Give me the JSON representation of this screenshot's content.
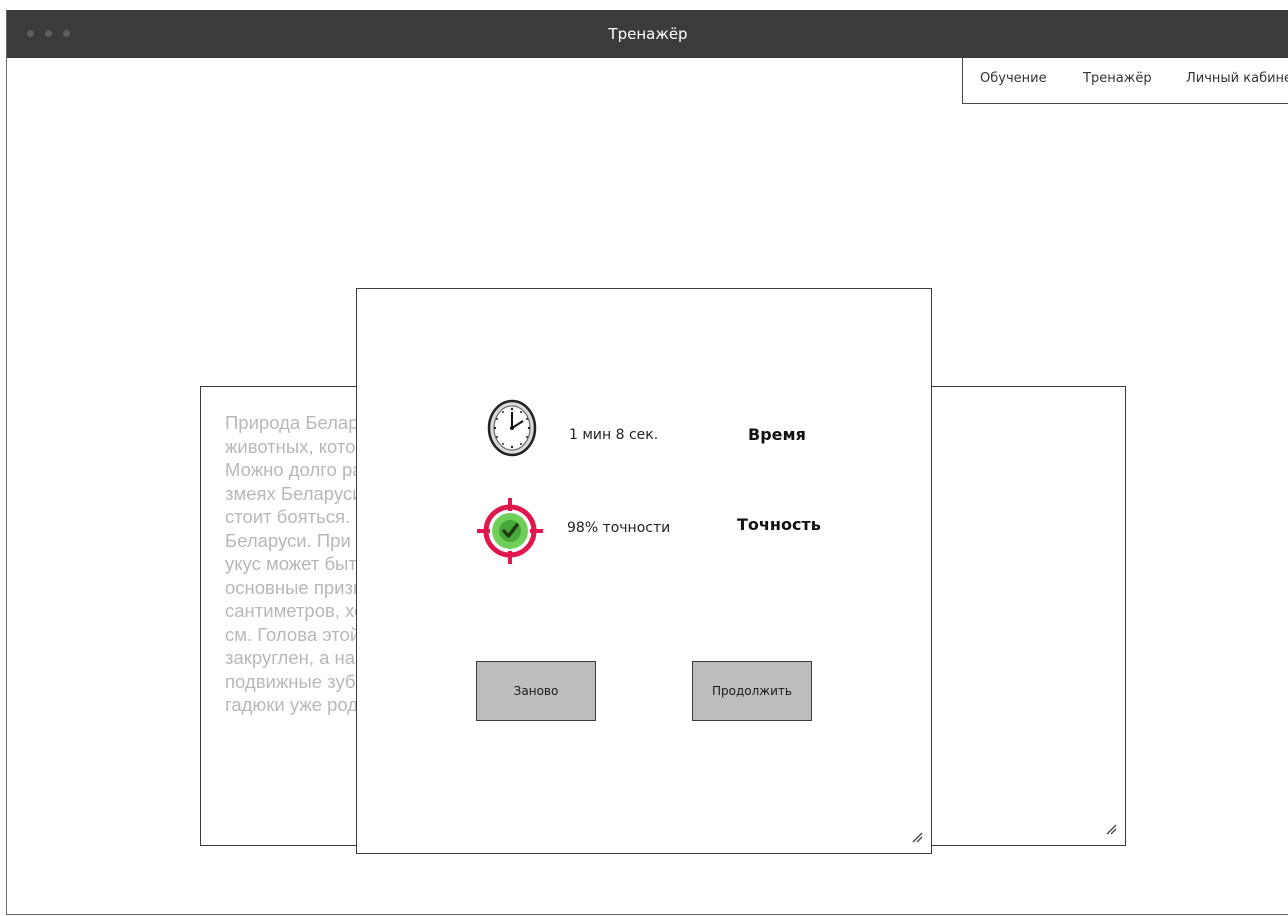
{
  "window": {
    "title": "Тренажёр"
  },
  "nav": {
    "items": [
      {
        "label": "Обучение"
      },
      {
        "label": "Тренажёр"
      },
      {
        "label": "Личный кабинет"
      }
    ]
  },
  "text_card": {
    "lines": [
      "Природа Беларуси богата: здесь обитает множество редких",
      "животных, которые занесены в Красную книгу нашей страны.",
      "Можно долго рассказывать о них, но сегодня остановиться на",
      "змеях Беларуси. Их всего несколько видов, и лишь один из них",
      "стоит бояться. Гадюка обыкновенная — единственная ядовитая змея",
      "Беларуси. При встрече с ней не стоит сильно волноваться, ведь ее",
      "укус может быть опасен лишь в редких случаях. Обратим внимание на",
      "основные признаки гадюки: длина ее тела не превышает 65",
      "сантиметров, хотя в отдельных случаях самки могут достигать 95",
      "см. Голова этой змеи треугольной формы и плоская. Кончик головы",
      "закруглен, а на верхней челюсти у нее располагаются крупные",
      "подвижные зубы. Уже при рождении, к слову, молодые",
      "гадюки уже родятся ядовитыми, как у взрослых змей."
    ]
  },
  "results": {
    "time_value": "1 мин 8 сек.",
    "time_label": "Время",
    "accuracy_value": "98% точности",
    "accuracy_label": "Точность",
    "accuracy_percent": 98,
    "icons": {
      "time": "clock-icon",
      "accuracy": "target-check-icon"
    },
    "colors": {
      "target_ring": "#e0174f",
      "target_fill": "#6fcf5a",
      "check": "#1f3a10"
    }
  },
  "buttons": {
    "restart": "Заново",
    "continue": "Продолжить"
  }
}
